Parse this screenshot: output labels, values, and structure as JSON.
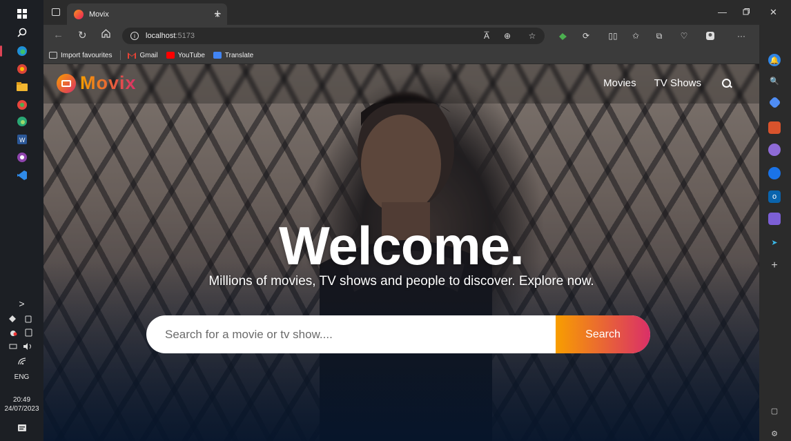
{
  "taskbar": {
    "clock_time": "20:49",
    "clock_date": "24/07/2023",
    "language": "ENG",
    "chevron": ">"
  },
  "browser": {
    "tab_title": "Movix",
    "tab_close": "×",
    "new_tab": "+",
    "address_host": "localhost",
    "address_port": ":5173",
    "more": "···",
    "reader": "A̅",
    "favourites": [
      {
        "label": "Import favourites",
        "color": "#8a8a8a"
      },
      {
        "label": "Gmail",
        "color": "#ea4335"
      },
      {
        "label": "YouTube",
        "color": "#ff0000"
      },
      {
        "label": "Translate",
        "color": "#4285f4"
      }
    ]
  },
  "site": {
    "logo_text": "Movix",
    "nav": {
      "movies": "Movies",
      "tv_shows": "TV Shows"
    },
    "hero": {
      "title": "Welcome.",
      "subtitle": "Millions of movies, TV shows and people to discover. Explore now.",
      "search_placeholder": "Search for a movie or tv show....",
      "search_value": "",
      "search_button": "Search"
    }
  },
  "colors": {
    "accent_start": "#f89e00",
    "accent_end": "#da2f68"
  }
}
